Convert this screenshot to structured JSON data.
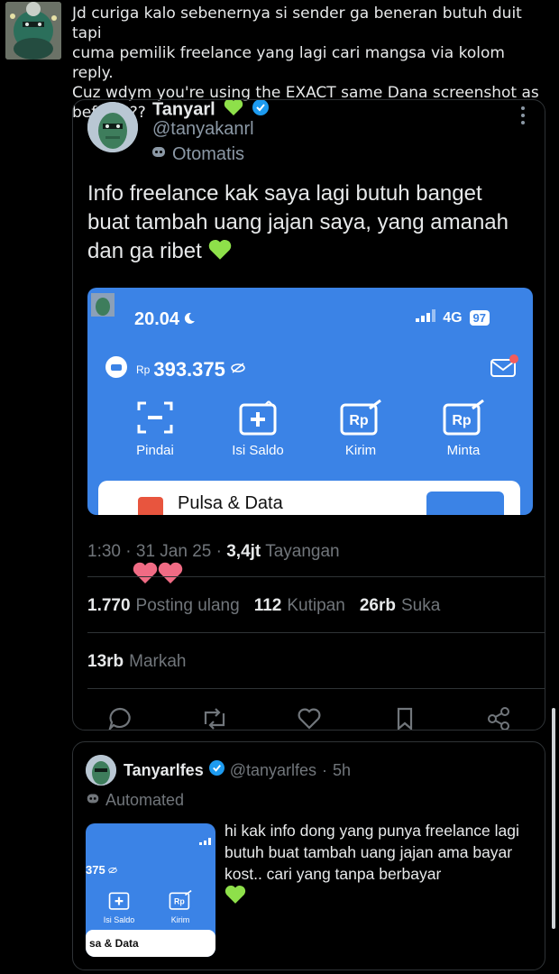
{
  "tweet": {
    "text": "Jd curiga kalo sebenernya si sender ga beneran butuh duit tapi\ncuma pemilik freelance yang lagi cari mangsa via kolom reply.\nCuz wdym you're using the EXACT same Dana screenshot as\nbefore???"
  },
  "quoted": {
    "name": "Tanyarl",
    "handle": "@tanyakanrl",
    "automated_label": "Otomatis",
    "body": "Info freelance kak saya lagi butuh banget buat tambah uang jajan saya, yang amanah dan ga ribet",
    "screenshot": {
      "time": "20.04",
      "network": "4G",
      "battery": "97",
      "currency": "Rp",
      "balance": "393.375",
      "actions": [
        "Pindai",
        "Isi Saldo",
        "Kirim",
        "Minta"
      ],
      "card_label": "Pulsa & Data"
    },
    "time": "1:30",
    "date": "31 Jan 25",
    "views_value": "3,4jt",
    "views_label": "Tayangan",
    "reposts_value": "1.770",
    "reposts_label": "Posting ulang",
    "quotes_value": "112",
    "quotes_label": "Kutipan",
    "likes_value": "26rb",
    "likes_label": "Suka",
    "bookmarks_value": "13rb",
    "bookmarks_label": "Markah"
  },
  "reply": {
    "name": "Tanyarlfes",
    "handle": "@tanyarlfes",
    "sep": "·",
    "age": "5h",
    "automated_label": "Automated",
    "thumb_balance": "375",
    "thumb_actions": [
      "Isi Saldo",
      "Kirim"
    ],
    "thumb_card_label": "sa & Data",
    "body": "hi kak info dong yang punya freelance lagi butuh buat tambah uang jajan ama bayar kost.. cari yang tanpa berbayar"
  },
  "colors": {
    "background": "#000000",
    "dana_blue": "#3b83e6",
    "heart_green": "#8ee04a",
    "verified_blue": "#1d9bf0",
    "pink_heart": "#f06b84"
  }
}
